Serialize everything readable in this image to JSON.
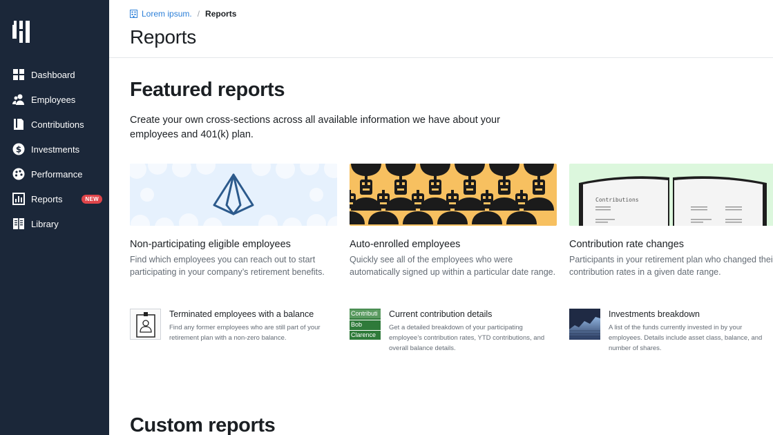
{
  "sidebar": {
    "items": [
      {
        "label": "Dashboard"
      },
      {
        "label": "Employees"
      },
      {
        "label": "Contributions"
      },
      {
        "label": "Investments"
      },
      {
        "label": "Performance"
      },
      {
        "label": "Reports",
        "badge": "NEW"
      },
      {
        "label": "Library"
      }
    ]
  },
  "breadcrumb": {
    "home": "Lorem ipsum.",
    "separator": "/",
    "current": "Reports"
  },
  "page": {
    "title": "Reports"
  },
  "featured": {
    "title": "Featured reports",
    "description": "Create your own cross-sections across all available information we have about your employees and 401(k) plan.",
    "cards": [
      {
        "title": "Non-participating eligible employees",
        "desc": "Find which employees you can reach out to start participating in your company’s retirement benefits."
      },
      {
        "title": "Auto-enrolled employees",
        "desc": "Quickly see all of the employees who were automatically signed up within a particular date range."
      },
      {
        "title": "Contribution rate changes",
        "desc": "Participants in your retirement plan who changed their contribution rates in a given date range.",
        "thumb_label": "Contributions"
      }
    ],
    "minis": [
      {
        "title": "Terminated employees with a balance",
        "desc": "Find any former employees who are still part of your retirement plan with a non-zero balance."
      },
      {
        "title": "Current contribution details",
        "desc": "Get a detailed breakdown of your participating employee’s contribution rates, YTD contributions, and overall balance details.",
        "thumb_rows": [
          "Contributi",
          "Bob",
          "Clarence"
        ]
      },
      {
        "title": "Investments breakdown",
        "desc": "A list of the funds currently invested in by your employees. Details include asset class, balance, and number of shares."
      }
    ]
  },
  "custom": {
    "title": "Custom reports"
  },
  "colors": {
    "sidebar": "#1b2739",
    "accent": "#2b7fd8",
    "badge": "#e0454a"
  }
}
